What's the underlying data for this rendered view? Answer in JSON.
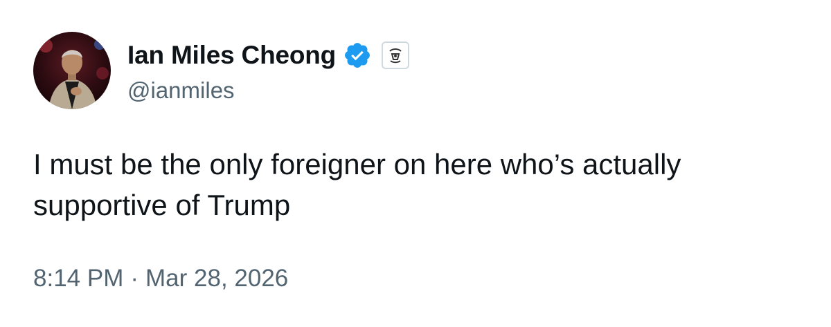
{
  "author": {
    "display_name": "Ian Miles Cheong",
    "handle": "@ianmiles",
    "verified_icon": "blue-verified-badge-icon",
    "affiliate_icon": "affiliate-badge-icon",
    "avatar": "profile-photo"
  },
  "tweet": {
    "text": "I must be the only foreigner on here who’s actually supportive of Trump",
    "time": "8:14 PM",
    "separator": "·",
    "date": "Mar 28, 2026"
  },
  "colors": {
    "text_primary": "#0f1419",
    "text_secondary": "#536471",
    "verified_blue": "#1d9bf0",
    "background": "#ffffff"
  }
}
